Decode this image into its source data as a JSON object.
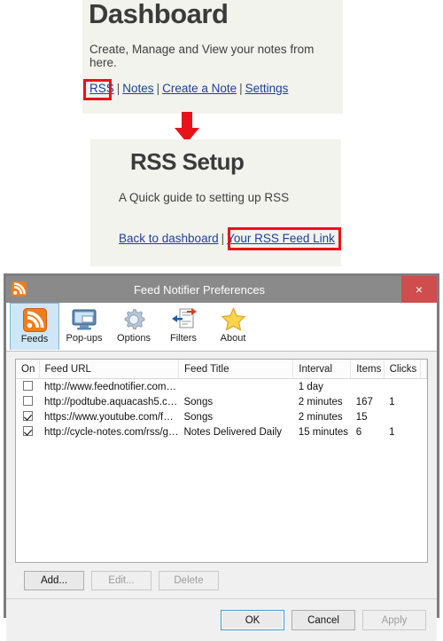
{
  "webpage": {
    "dashboard": {
      "title": "Dashboard",
      "subtitle": "Create, Manage and View your notes from here.",
      "links": [
        {
          "label": "RSS",
          "highlighted": true
        },
        {
          "label": "Notes",
          "highlighted": false
        },
        {
          "label": "Create a Note",
          "highlighted": false
        },
        {
          "label": "Settings",
          "highlighted": false
        }
      ],
      "separator": "|"
    },
    "rss_setup": {
      "title": "RSS Setup",
      "subtitle": "A Quick guide to setting up RSS",
      "links": [
        {
          "label": "Back to dashboard",
          "highlighted": false
        },
        {
          "label": "Your RSS Feed Link",
          "highlighted": true
        }
      ],
      "separator": "|"
    },
    "annotation": {
      "arrow_icon": "down-arrow-icon",
      "highlight_color": "#e8131a",
      "link_color": "#1d3f9e",
      "panel_bg": "#f1f3ec"
    }
  },
  "window": {
    "title": "Feed Notifier Preferences",
    "app_icon": "rss-icon",
    "close_label": "×",
    "titlebar_color": "#8a8a8a",
    "close_color": "#cf4d4d",
    "toolbar": [
      {
        "label": "Feeds",
        "icon": "rss-icon",
        "active": true
      },
      {
        "label": "Pop-ups",
        "icon": "monitor-icon",
        "active": false
      },
      {
        "label": "Options",
        "icon": "gear-icon",
        "active": false
      },
      {
        "label": "Filters",
        "icon": "filter-icon",
        "active": false
      },
      {
        "label": "About",
        "icon": "star-icon",
        "active": false
      }
    ],
    "table": {
      "columns": [
        "On",
        "Feed URL",
        "Feed Title",
        "Interval",
        "Items",
        "Clicks",
        ""
      ],
      "rows": [
        {
          "on": false,
          "url": "http://www.feednotifier.com…",
          "title": "",
          "interval": "1 day",
          "items": "",
          "clicks": ""
        },
        {
          "on": false,
          "url": "http://podtube.aquacash5.c…",
          "title": "Songs",
          "interval": "2 minutes",
          "items": "167",
          "clicks": "1"
        },
        {
          "on": true,
          "url": "https://www.youtube.com/f…",
          "title": "Songs",
          "interval": "2 minutes",
          "items": "15",
          "clicks": ""
        },
        {
          "on": true,
          "url": "http://cycle-notes.com/rss/g…",
          "title": "Notes Delivered Daily",
          "interval": "15 minutes",
          "items": "6",
          "clicks": "1"
        }
      ]
    },
    "feed_buttons": [
      {
        "label": "Add...",
        "enabled": true
      },
      {
        "label": "Edit...",
        "enabled": false
      },
      {
        "label": "Delete",
        "enabled": false
      }
    ],
    "footer_buttons": [
      {
        "label": "OK",
        "enabled": true,
        "default": true
      },
      {
        "label": "Cancel",
        "enabled": true,
        "default": false
      },
      {
        "label": "Apply",
        "enabled": false,
        "default": false
      }
    ]
  }
}
